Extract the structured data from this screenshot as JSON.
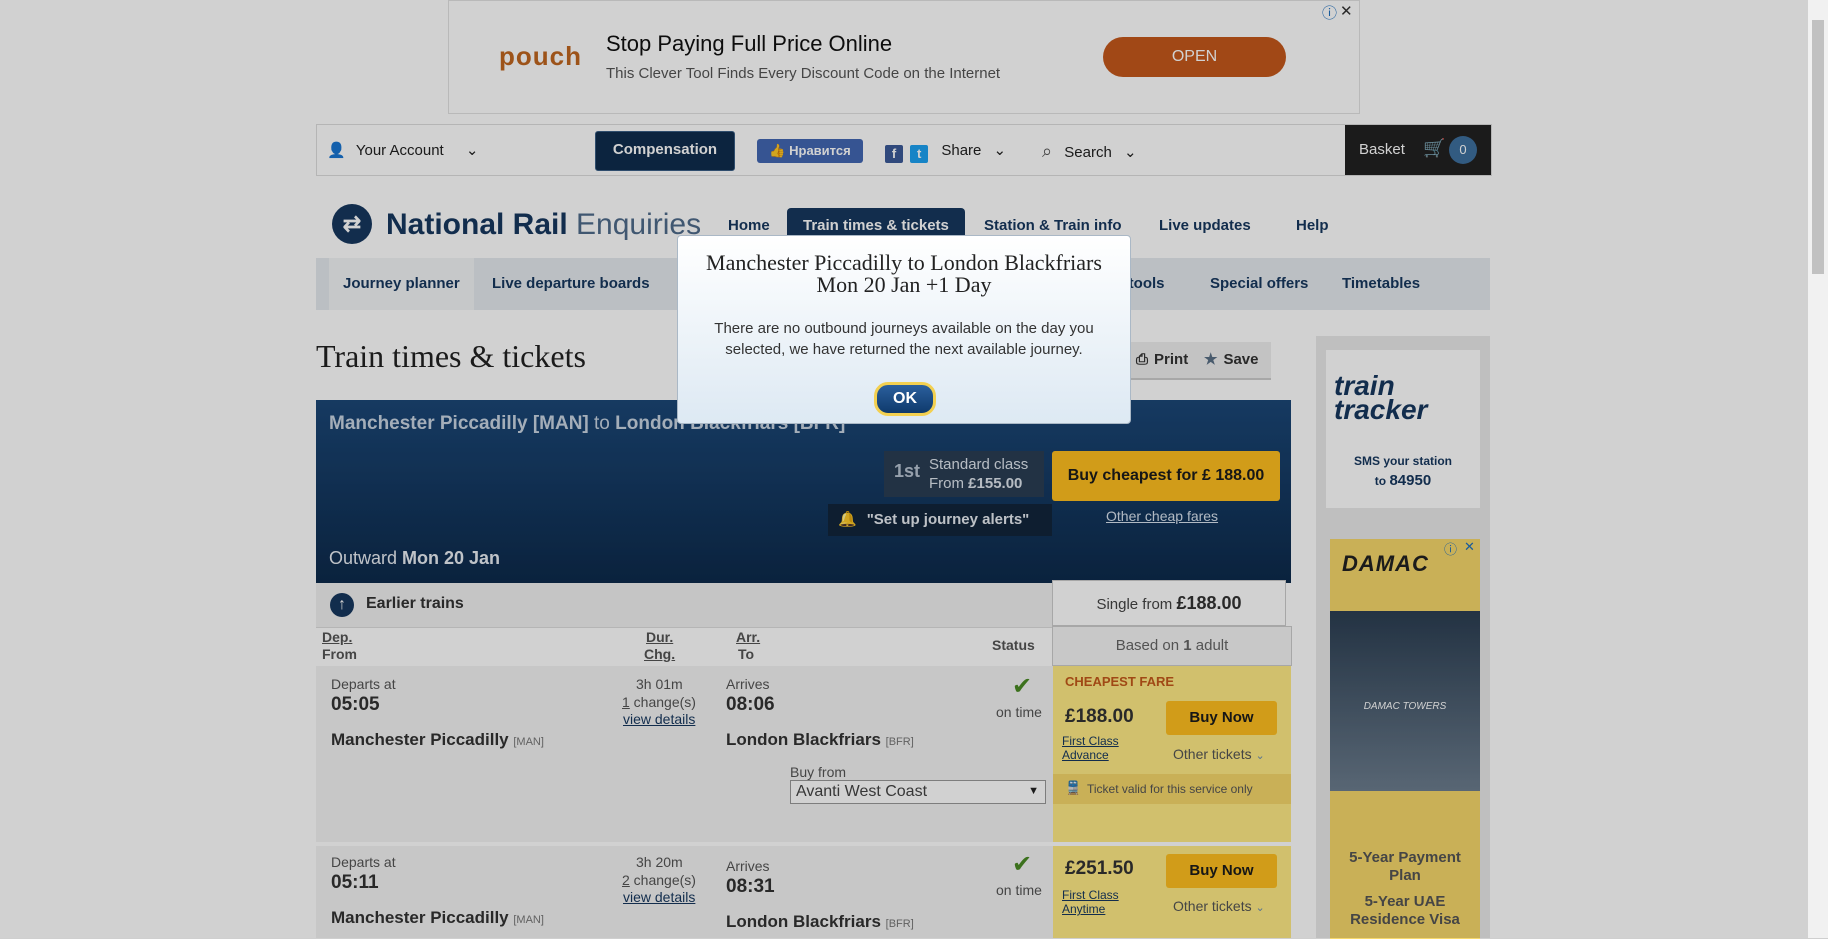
{
  "ad": {
    "brand": "pouch",
    "title": "Stop Paying Full Price Online",
    "subtitle": "This Clever Tool Finds Every Discount Code on the Internet",
    "cta": "OPEN"
  },
  "topbar": {
    "account": "Your Account",
    "compensation": "Compensation",
    "like": "Нравится",
    "share": "Share",
    "search": "Search",
    "basket": "Basket",
    "basket_count": "0"
  },
  "brand": {
    "name_strong": "National Rail",
    "name_light": " Enquiries"
  },
  "nav": [
    "Home",
    "Train times & tickets",
    "Station & Train info",
    "Live updates",
    "Help"
  ],
  "subnav": [
    "Journey planner",
    "Live departure boards",
    "el tools",
    "Special offers",
    "Timetables"
  ],
  "page": {
    "heading": "Train times & tickets",
    "print": "Print",
    "save": "Save"
  },
  "journey": {
    "title_from": "Manchester Piccadilly [MAN]",
    "title_to_word": " to ",
    "title_to": "London Blackfriars [BFR]",
    "class_badge": "1st",
    "class_label": "Standard class",
    "class_from": "From ",
    "class_price": "£155.00",
    "buy_cheapest": "Buy cheapest for £ 188.00",
    "other_cheap": "Other cheap fares",
    "alerts": "\"Set up journey alerts\"",
    "outward_label": "Outward ",
    "outward_date": "Mon 20 Jan",
    "earlier": "Earlier trains",
    "single_from": "Single from ",
    "single_price": "£188.00",
    "based_on": "Based on ",
    "based_count": "1",
    "based_unit": " adult"
  },
  "columns": {
    "dep": "Dep.",
    "from": "From",
    "dur": "Dur.",
    "chg": "Chg.",
    "arr": "Arr.",
    "to": "To",
    "status": "Status"
  },
  "trains": [
    {
      "departs_label": "Departs at",
      "dep_time": "05:05",
      "duration": "3h 01m",
      "changes_num": "1",
      "changes_text": " change(s)",
      "view_details": "view details",
      "arrives_label": "Arrives",
      "arr_time": "08:06",
      "status": "on time",
      "from_station": "Manchester Piccadilly",
      "from_code": "[MAN]",
      "to_station": "London Blackfriars",
      "to_code": "[BFR]",
      "buy_from_label": "Buy from",
      "buy_from_value": "Avanti West Coast",
      "fare_tag": "CHEAPEST FARE",
      "price": "£188.00",
      "fare_type": "First Class Advance",
      "buy_now": "Buy Now",
      "other_tickets": "Other tickets",
      "ticket_note": "Ticket valid for this service only"
    },
    {
      "departs_label": "Departs at",
      "dep_time": "05:11",
      "duration": "3h 20m",
      "changes_num": "2",
      "changes_text": " change(s)",
      "view_details": "view details",
      "arrives_label": "Arrives",
      "arr_time": "08:31",
      "status": "on time",
      "from_station": "Manchester Piccadilly",
      "from_code": "[MAN]",
      "to_station": "London Blackfriars",
      "to_code": "[BFR]",
      "price": "£251.50",
      "fare_type": "First Class Anytime",
      "buy_now": "Buy Now",
      "other_tickets": "Other tickets"
    }
  ],
  "side": {
    "tt_line1": "train",
    "tt_line2": "tracker",
    "tt_sms": "SMS your station",
    "tt_to": "to ",
    "tt_num": "84950",
    "damac_brand": "DAMAC",
    "damac_towers": "DAMAC TOWERS",
    "damac_plan": "5-Year Payment Plan",
    "damac_visa": "5-Year UAE Residence Visa"
  },
  "modal": {
    "title": "Manchester Piccadilly to London Blackfriars Mon 20 Jan +1 Day",
    "message": "There are no outbound journeys available on the day you selected, we have returned the next available journey.",
    "ok": "OK"
  }
}
